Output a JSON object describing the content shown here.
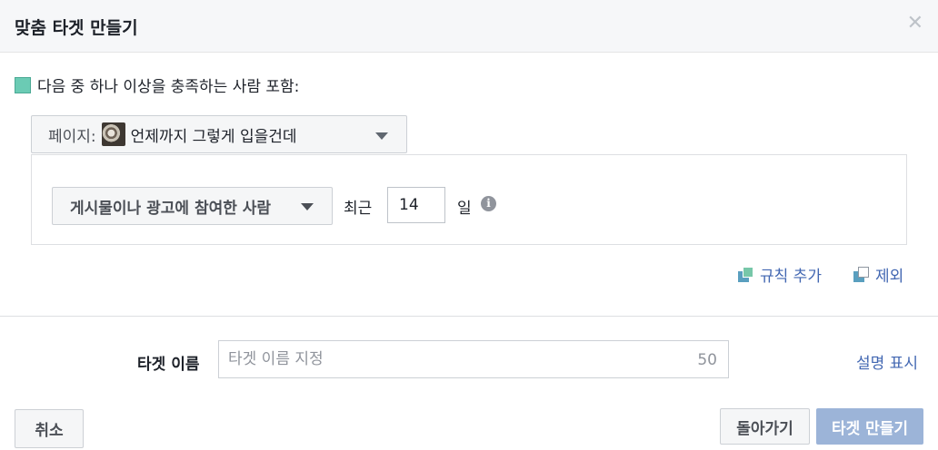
{
  "dialog": {
    "title": "맞춤 타겟 만들기",
    "close_icon": "close-icon"
  },
  "include": {
    "swatch_color": "#6bcbb4",
    "text": "다음 중 하나 이상을 충족하는 사람 포함:"
  },
  "page_selector": {
    "label": "페이지:",
    "page_name": "언제까지 그렇게 입을건데",
    "icon": "chevron-down-icon"
  },
  "rule": {
    "engagement_selected": "게시물이나 광고에 참여한 사람",
    "recent_label": "최근",
    "days_value": "14",
    "days_label": "일",
    "info_icon": "info-icon",
    "info_glyph": "i"
  },
  "rule_actions": {
    "add_rule": "규칙 추가",
    "remove": "제외"
  },
  "audience_name": {
    "label": "타겟 이름",
    "placeholder": "타겟 이름 지정",
    "char_limit": "50",
    "description_link": "설명 표시"
  },
  "footer": {
    "cancel": "취소",
    "back": "돌아가기",
    "create": "타겟 만들기"
  },
  "colors": {
    "link": "#4267b2",
    "primary_disabled": "#9cb4d8"
  }
}
